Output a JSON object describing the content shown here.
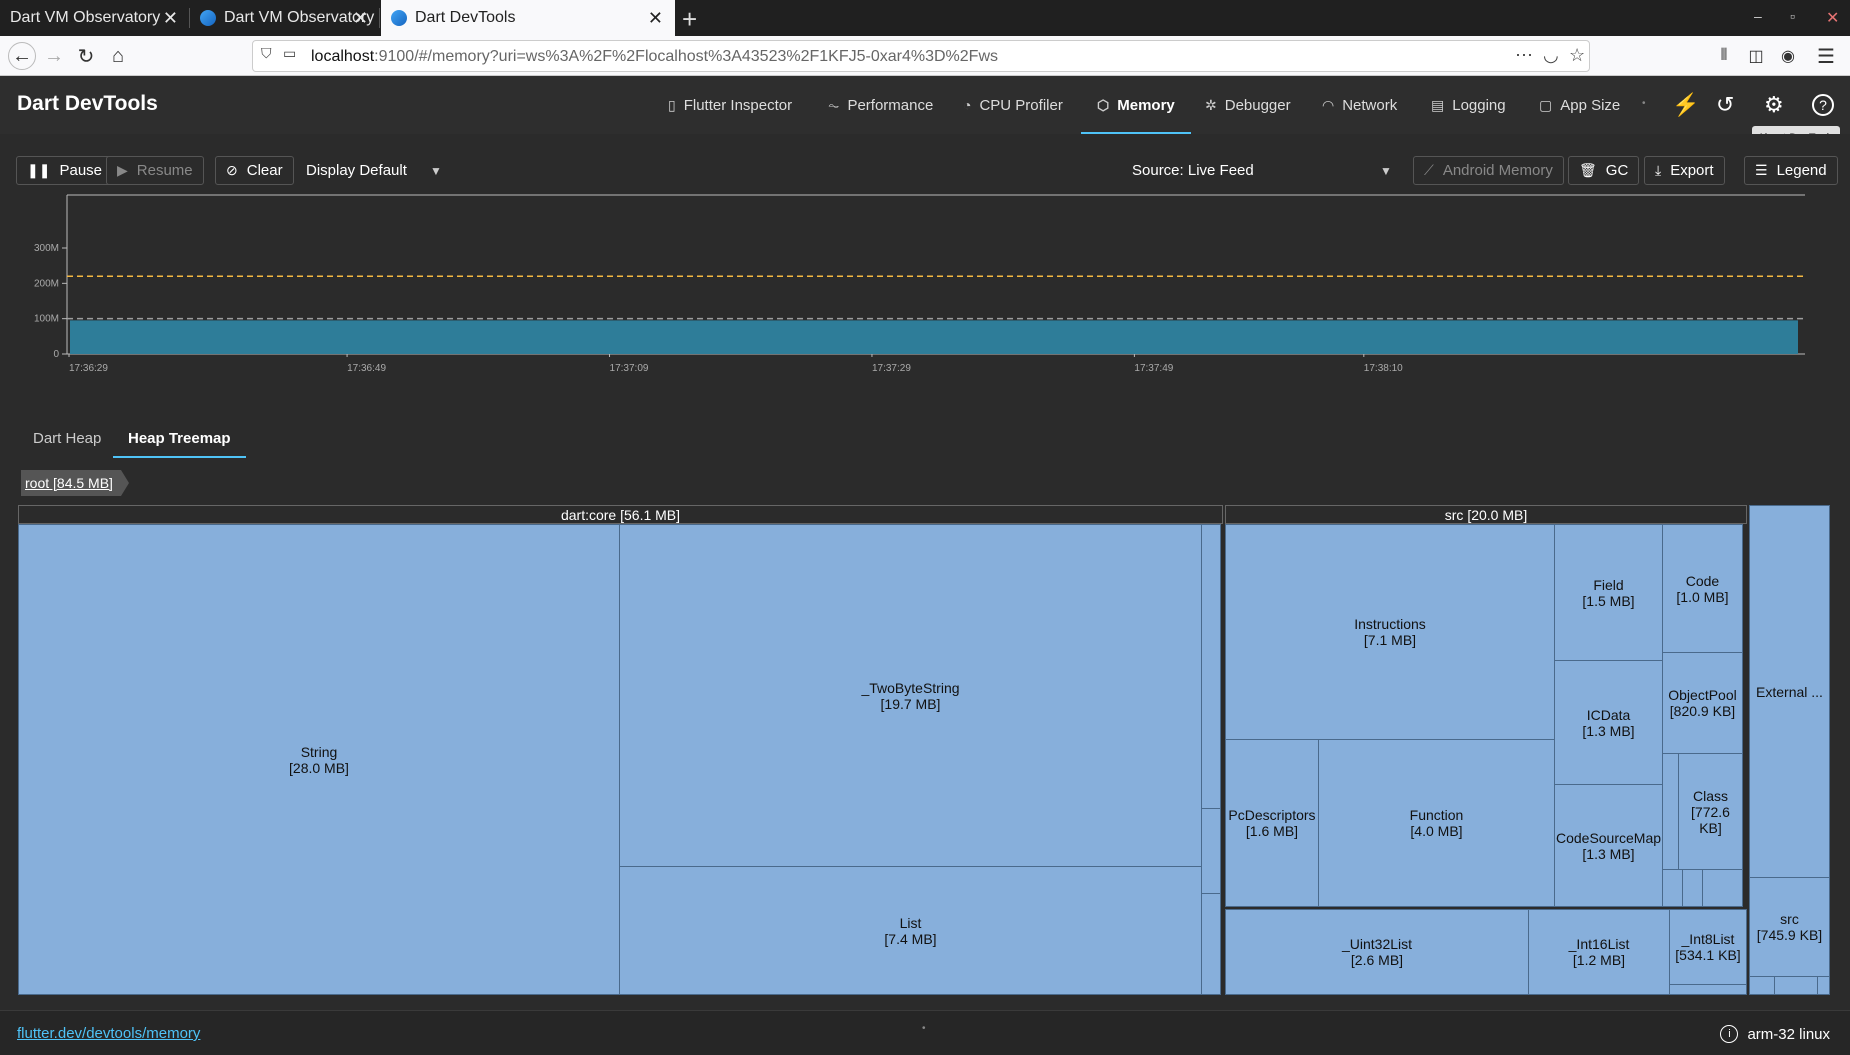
{
  "browser": {
    "tabs": [
      {
        "label": "Dart VM Observatory"
      },
      {
        "label": "Dart VM Observatory"
      },
      {
        "label": "Dart DevTools"
      }
    ],
    "url_host": "localhost",
    "url_rest": ":9100/#/memory?uri=ws%3A%2F%2Flocalhost%3A43523%2F1KFJ5-0xar4%3D%2Fws"
  },
  "app": {
    "title": "Dart DevTools",
    "tabs": [
      {
        "label": "Flutter Inspector"
      },
      {
        "label": "Performance"
      },
      {
        "label": "CPU Profiler"
      },
      {
        "label": "Memory"
      },
      {
        "label": "Debugger"
      },
      {
        "label": "Network"
      },
      {
        "label": "Logging"
      },
      {
        "label": "App Size"
      }
    ],
    "tooltip": "About DevTools"
  },
  "controls": {
    "pause": "Pause",
    "resume": "Resume",
    "clear": "Clear",
    "display": "Display Default",
    "source": "Source: Live Feed",
    "android_memory": "Android Memory",
    "gc": "GC",
    "export": "Export",
    "legend": "Legend"
  },
  "chart_data": {
    "type": "area",
    "y_ticks": [
      "300M",
      "200M",
      "100M",
      "0"
    ],
    "x_ticks": [
      "17:36:29",
      "17:36:49",
      "17:37:09",
      "17:37:29",
      "17:37:49",
      "17:38:10"
    ],
    "ylim": [
      0,
      450
    ],
    "series": [
      {
        "name": "",
        "values": [
          95,
          95,
          95,
          95,
          95,
          95
        ],
        "color": "#2e7d99"
      }
    ],
    "dashed_lines": [
      {
        "value": 220,
        "color": "#f5b942"
      },
      {
        "value": 100,
        "color": "#9e9e9e"
      }
    ]
  },
  "subtabs": [
    {
      "label": "Dart Heap"
    },
    {
      "label": "Heap Treemap"
    }
  ],
  "treemap": {
    "breadcrumb": "root [84.5 MB]",
    "groups": [
      {
        "label": "dart:core [56.1 MB]"
      },
      {
        "label": "src [20.0 MB]"
      }
    ],
    "cells": {
      "string": "String\n[28.0 MB]",
      "twobyte": "_TwoByteString\n[19.7 MB]",
      "list": "List\n[7.4 MB]",
      "instructions": "Instructions\n[7.1 MB]",
      "field": "Field\n[1.5 MB]",
      "code": "Code\n[1.0 MB]",
      "icdata": "ICData\n[1.3 MB]",
      "objectpool": "ObjectPool\n[820.9 KB]",
      "pcdesc": "PcDescriptors\n[1.6 MB]",
      "function": "Function\n[4.0 MB]",
      "codesourcemap": "CodeSourceMap\n[1.3 MB]",
      "class": "Class\n[772.6 KB]",
      "uint32": "_Uint32List\n[2.6 MB]",
      "int16": "_Int16List\n[1.2 MB]",
      "int8": "_Int8List\n[534.1 KB]",
      "external": "External ...",
      "src2": "src\n[745.9 KB]"
    }
  },
  "footer": {
    "link": "flutter.dev/devtools/memory",
    "platform": "arm-32 linux"
  }
}
